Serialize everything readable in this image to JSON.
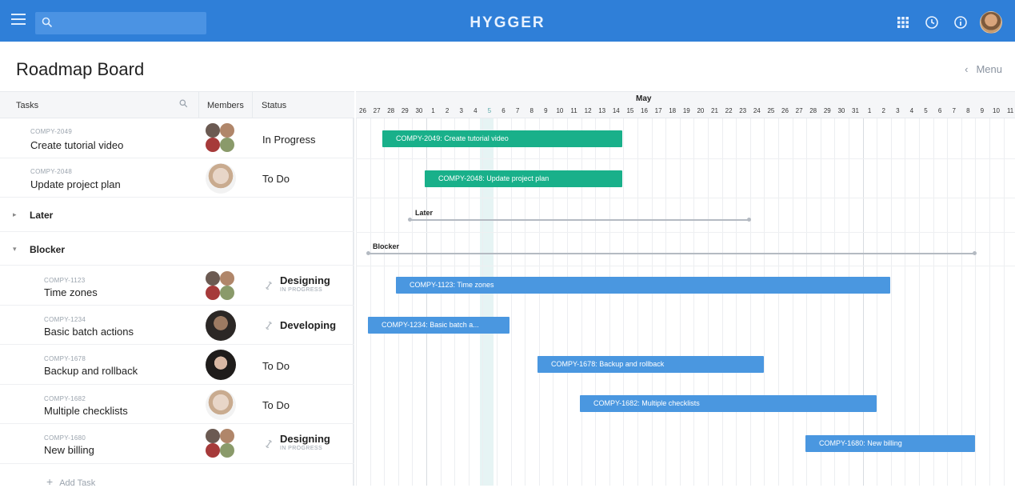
{
  "header": {
    "logo": "HYGGER",
    "search_placeholder": "",
    "icons": [
      "menu-icon",
      "search-icon",
      "apps-grid-icon",
      "clock-icon",
      "info-icon",
      "user-avatar"
    ]
  },
  "page": {
    "title": "Roadmap Board",
    "menu_label": "Menu"
  },
  "columns": {
    "tasks": "Tasks",
    "members": "Members",
    "status": "Status"
  },
  "timeline": {
    "month": "May",
    "days": [
      "26",
      "27",
      "28",
      "29",
      "30",
      "1",
      "2",
      "3",
      "4",
      "5",
      "6",
      "7",
      "8",
      "9",
      "10",
      "11",
      "12",
      "13",
      "14",
      "15",
      "16",
      "17",
      "18",
      "19",
      "20",
      "21",
      "22",
      "23",
      "24",
      "25",
      "26",
      "27",
      "28",
      "29",
      "30",
      "31",
      "1",
      "2",
      "3",
      "4",
      "5",
      "6",
      "7",
      "8",
      "9",
      "10",
      "11"
    ],
    "today": "5"
  },
  "rows": [
    {
      "code": "COMPY-2049",
      "title": "Create tutorial video",
      "status": "In Progress",
      "bar_label": "COMPY-2049: Create tutorial video"
    },
    {
      "code": "COMPY-2048",
      "title": "Update project plan",
      "status": "To Do",
      "bar_label": "COMPY-2048: Update project plan"
    }
  ],
  "groups": [
    {
      "name": "Later",
      "bar_label": "Later"
    },
    {
      "name": "Blocker",
      "bar_label": "Blocker"
    }
  ],
  "blocker_rows": [
    {
      "code": "COMPY-1123",
      "title": "Time zones",
      "status": "Designing",
      "substatus": "IN PROGRESS",
      "bar_label": "COMPY-1123: Time zones"
    },
    {
      "code": "COMPY-1234",
      "title": "Basic batch actions",
      "status": "Developing",
      "bar_label": "COMPY-1234: Basic batch a..."
    },
    {
      "code": "COMPY-1678",
      "title": "Backup and rollback",
      "status": "To Do",
      "bar_label": "COMPY-1678: Backup and rollback"
    },
    {
      "code": "COMPY-1682",
      "title": "Multiple checklists",
      "status": "To Do",
      "bar_label": "COMPY-1682: Multiple checklists"
    },
    {
      "code": "COMPY-1680",
      "title": "New billing",
      "status": "Designing",
      "substatus": "IN PROGRESS",
      "bar_label": "COMPY-1680: New billing"
    }
  ],
  "add_task": "Add Task",
  "colors": {
    "topbar": "#2f7fd8",
    "green_bar": "#19b08a",
    "blue_bar": "#4a97e0"
  }
}
